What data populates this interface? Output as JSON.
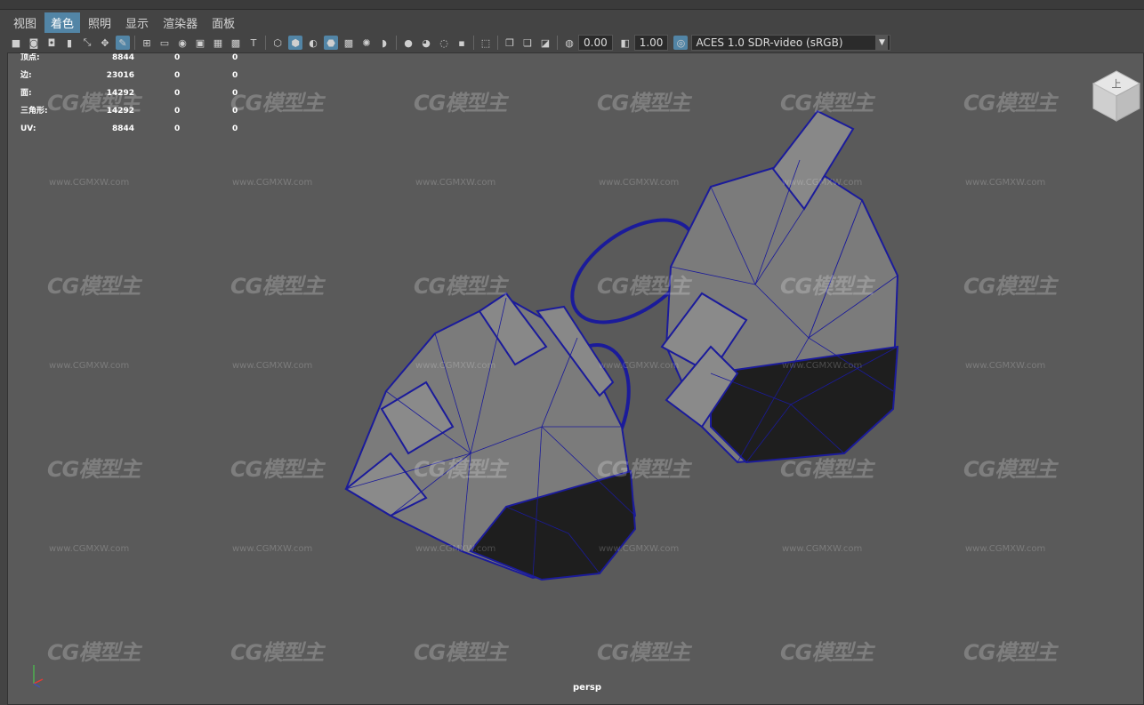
{
  "menu": [
    {
      "label": "视图",
      "active": false
    },
    {
      "label": "着色",
      "active": true
    },
    {
      "label": "照明",
      "active": false
    },
    {
      "label": "显示",
      "active": false
    },
    {
      "label": "渲染器",
      "active": false
    },
    {
      "label": "面板",
      "active": false
    }
  ],
  "toolbar": {
    "exposure_value": "0.00",
    "gamma_value": "1.00",
    "color_space": "ACES 1.0 SDR-video (sRGB)"
  },
  "hud": {
    "rows": [
      {
        "label": "顶点:",
        "v1": "8844",
        "v2": "0",
        "v3": "0"
      },
      {
        "label": "边:",
        "v1": "23016",
        "v2": "0",
        "v3": "0"
      },
      {
        "label": "面:",
        "v1": "14292",
        "v2": "0",
        "v3": "0"
      },
      {
        "label": "三角形:",
        "v1": "14292",
        "v2": "0",
        "v3": "0"
      },
      {
        "label": "UV:",
        "v1": "8844",
        "v2": "0",
        "v3": "0"
      }
    ]
  },
  "viewport": {
    "camera_label": "persp",
    "viewcube_face": "上"
  },
  "watermark": {
    "text": "CG模型主",
    "url": "www.CGMXW.com"
  },
  "colors": {
    "background": "#444444",
    "viewport": "#5a5a5a",
    "active_menu": "#5285a6",
    "wire": "#1b1b9a",
    "shade": "#7b7b7b",
    "dark": "#1e1e1e"
  },
  "icons": [
    "camera-icon",
    "grid-icon",
    "wireframe-icon",
    "smooth-shade-icon",
    "light-icon",
    "isolate-icon",
    "xray-icon",
    "exposure-icon",
    "gamma-icon",
    "color-manage-icon"
  ]
}
